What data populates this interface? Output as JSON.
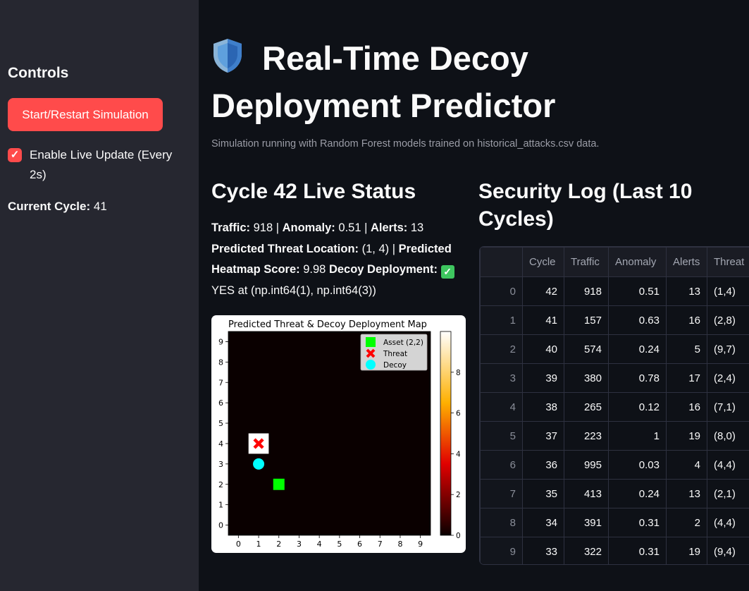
{
  "sidebar": {
    "title": "Controls",
    "start_button": "Start/Restart Simulation",
    "live_update_label": "Enable Live Update (Every 2s)",
    "live_update_checked": true,
    "current_cycle_label": "Current Cycle:",
    "current_cycle_value": "41"
  },
  "main": {
    "title": "Real-Time Decoy Deployment Predictor",
    "caption": "Simulation running with Random Forest models trained on historical_attacks.csv data.",
    "status_heading": "Cycle 42 Live Status",
    "status": {
      "traffic_label": "Traffic:",
      "traffic_value": "918",
      "anomaly_label": "Anomaly:",
      "anomaly_value": "0.51",
      "alerts_label": "Alerts:",
      "alerts_value": "13",
      "location_label": "Predicted Threat Location:",
      "location_value": "(1, 4)",
      "heatmap_label": "Predicted Heatmap Score:",
      "heatmap_value": "9.98",
      "decoy_label": "Decoy Deployment:",
      "decoy_value": "YES at (np.int64(1), np.int64(3))"
    },
    "log_heading": "Security Log (Last 10 Cycles)",
    "log_table": {
      "columns": [
        "",
        "Cycle",
        "Traffic",
        "Anomaly",
        "Alerts",
        "Threat"
      ],
      "rows": [
        [
          "0",
          "42",
          "918",
          "0.51",
          "13",
          "(1,4)"
        ],
        [
          "1",
          "41",
          "157",
          "0.63",
          "16",
          "(2,8)"
        ],
        [
          "2",
          "40",
          "574",
          "0.24",
          "5",
          "(9,7)"
        ],
        [
          "3",
          "39",
          "380",
          "0.78",
          "17",
          "(2,4)"
        ],
        [
          "4",
          "38",
          "265",
          "0.12",
          "16",
          "(7,1)"
        ],
        [
          "5",
          "37",
          "223",
          "1",
          "19",
          "(8,0)"
        ],
        [
          "6",
          "36",
          "995",
          "0.03",
          "4",
          "(4,4)"
        ],
        [
          "7",
          "35",
          "413",
          "0.24",
          "13",
          "(2,1)"
        ],
        [
          "8",
          "34",
          "391",
          "0.31",
          "2",
          "(4,4)"
        ],
        [
          "9",
          "33",
          "322",
          "0.31",
          "19",
          "(9,4)"
        ]
      ]
    }
  },
  "chart_data": {
    "type": "heatmap",
    "title": "Predicted Threat & Decoy Deployment Map",
    "xlim": [
      0,
      9
    ],
    "ylim": [
      0,
      9
    ],
    "xticks": [
      "0",
      "1",
      "2",
      "3",
      "4",
      "5",
      "6",
      "7",
      "8",
      "9"
    ],
    "yticks": [
      "0",
      "1",
      "2",
      "3",
      "4",
      "5",
      "6",
      "7",
      "8",
      "9"
    ],
    "colorbar_ticks": [
      "0",
      "2",
      "4",
      "6",
      "8"
    ],
    "colorbar_range": [
      0,
      10
    ],
    "hot_cell": {
      "x": 1,
      "y": 4,
      "value": 9.98
    },
    "points": [
      {
        "name": "Asset (2,2)",
        "x": 2,
        "y": 2,
        "marker": "square",
        "color": "#00ff00"
      },
      {
        "name": "Threat",
        "x": 1,
        "y": 4,
        "marker": "x",
        "color": "#ff0000"
      },
      {
        "name": "Decoy",
        "x": 1,
        "y": 3,
        "marker": "circle",
        "color": "#00ffff"
      }
    ],
    "background_color": "#0a0000",
    "legend_position": "upper right"
  }
}
